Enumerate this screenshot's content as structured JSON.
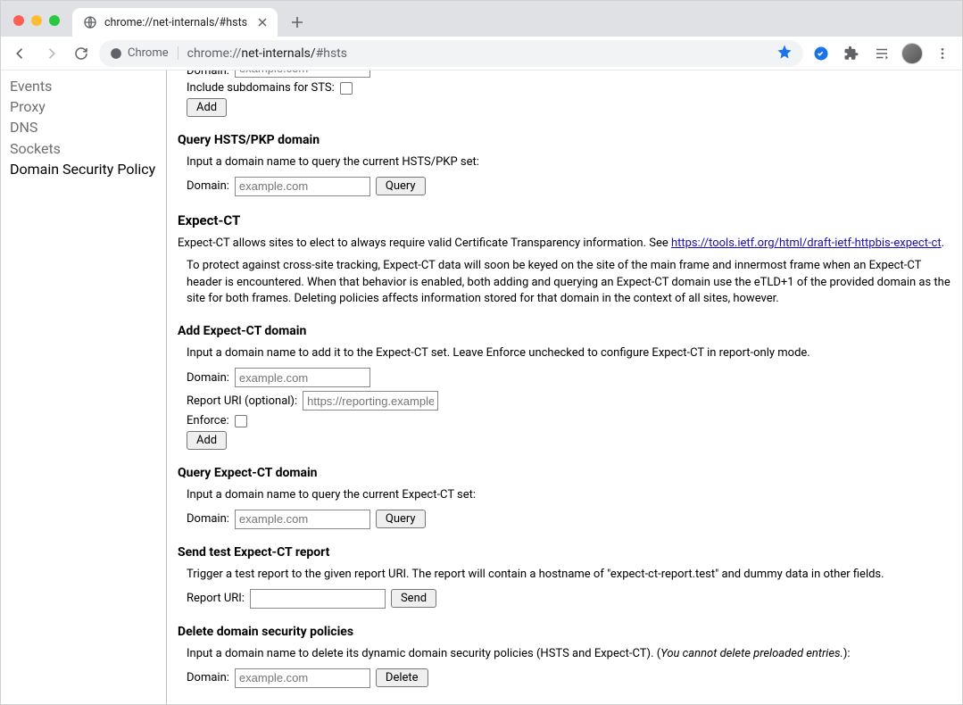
{
  "tab": {
    "title": "chrome://net-internals/#hsts"
  },
  "omnibox": {
    "chip_label": "Chrome",
    "url_prefix": "chrome://",
    "url_bold": "net-internals/",
    "url_hash": "#hsts"
  },
  "sidebar": {
    "items": [
      {
        "label": "Events",
        "active": false
      },
      {
        "label": "Proxy",
        "active": false
      },
      {
        "label": "DNS",
        "active": false
      },
      {
        "label": "Sockets",
        "active": false
      },
      {
        "label": "Domain Security Policy",
        "active": true
      }
    ]
  },
  "cutoff": {
    "domain_label": "Domain:",
    "domain_placeholder": "example.com",
    "include_label": "Include subdomains for STS:",
    "add_button": "Add"
  },
  "query_hsts": {
    "heading": "Query HSTS/PKP domain",
    "desc": "Input a domain name to query the current HSTS/PKP set:",
    "domain_label": "Domain:",
    "domain_placeholder": "example.com",
    "button": "Query"
  },
  "expect_ct": {
    "heading": "Expect-CT",
    "desc_pre": "Expect-CT allows sites to elect to always require valid Certificate Transparency information. See ",
    "link": "https://tools.ietf.org/html/draft-ietf-httpbis-expect-ct",
    "desc_post": ".",
    "note": "To protect against cross-site tracking, Expect-CT data will soon be keyed on the site of the main frame and innermost frame when an Expect-CT header is encountered. When that behavior is enabled, both adding and querying an Expect-CT domain use the eTLD+1 of the provided domain as the site for both frames. Deleting policies affects information stored for that domain in the context of all sites, however."
  },
  "add_ect": {
    "heading": "Add Expect-CT domain",
    "desc": "Input a domain name to add it to the Expect-CT set. Leave Enforce unchecked to configure Expect-CT in report-only mode.",
    "domain_label": "Domain:",
    "domain_placeholder": "example.com",
    "uri_label": "Report URI (optional):",
    "uri_placeholder": "https://reporting.example",
    "enforce_label": "Enforce:",
    "button": "Add"
  },
  "query_ect": {
    "heading": "Query Expect-CT domain",
    "desc": "Input a domain name to query the current Expect-CT set:",
    "domain_label": "Domain:",
    "domain_placeholder": "example.com",
    "button": "Query"
  },
  "send_ect": {
    "heading": "Send test Expect-CT report",
    "desc": "Trigger a test report to the given report URI. The report will contain a hostname of \"expect-ct-report.test\" and dummy data in other fields.",
    "uri_label": "Report URI:",
    "button": "Send"
  },
  "delete": {
    "heading": "Delete domain security policies",
    "desc_pre": "Input a domain name to delete its dynamic domain security policies (HSTS and Expect-CT). (",
    "desc_italic": "You cannot delete preloaded entries.",
    "desc_post": "):",
    "domain_label": "Domain:",
    "domain_placeholder": "example.com",
    "button": "Delete"
  }
}
